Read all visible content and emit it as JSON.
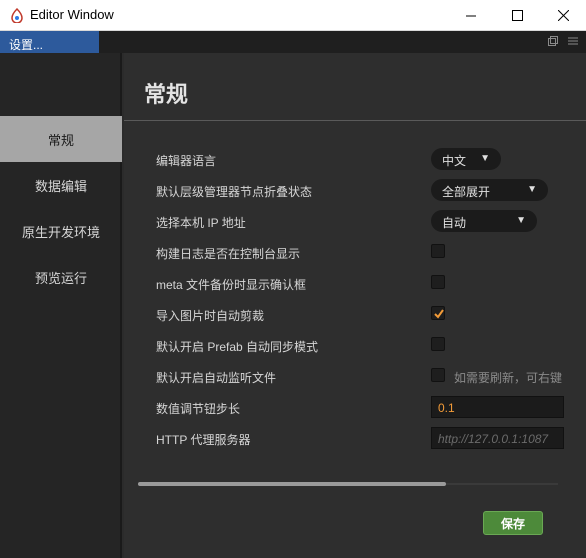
{
  "window": {
    "title": "Editor Window",
    "icon": "cocos-app-icon"
  },
  "tab": {
    "label": "设置..."
  },
  "sidebar": {
    "items": [
      {
        "label": "常规",
        "active": true
      },
      {
        "label": "数据编辑",
        "active": false
      },
      {
        "label": "原生开发环境",
        "active": false
      },
      {
        "label": "预览运行",
        "active": false
      }
    ]
  },
  "main": {
    "title": "常规",
    "settings": [
      {
        "label": "编辑器语言",
        "type": "select",
        "value": "中文"
      },
      {
        "label": "默认层级管理器节点折叠状态",
        "type": "select",
        "value": "全部展开"
      },
      {
        "label": "选择本机 IP 地址",
        "type": "select",
        "value": "自动"
      },
      {
        "label": "构建日志是否在控制台显示",
        "type": "checkbox",
        "checked": false
      },
      {
        "label": "meta 文件备份时显示确认框",
        "type": "checkbox",
        "checked": false
      },
      {
        "label": "导入图片时自动剪裁",
        "type": "checkbox",
        "checked": true
      },
      {
        "label": "默认开启 Prefab 自动同步模式",
        "type": "checkbox",
        "checked": false
      },
      {
        "label": "默认开启自动监听文件",
        "type": "checkbox",
        "checked": false,
        "hint": "如需要刷新，可右键"
      },
      {
        "label": "数值调节钮步长",
        "type": "number",
        "value": "0.1"
      },
      {
        "label": "HTTP 代理服务器",
        "type": "text",
        "value": "",
        "placeholder": "http://127.0.0.1:1087"
      }
    ],
    "save_label": "保存"
  },
  "colors": {
    "tab_active": "#2d5a9c",
    "accent_orange": "#f29b38",
    "save_button": "#4d8a3a",
    "sidebar_active": "#a6a6a6"
  }
}
